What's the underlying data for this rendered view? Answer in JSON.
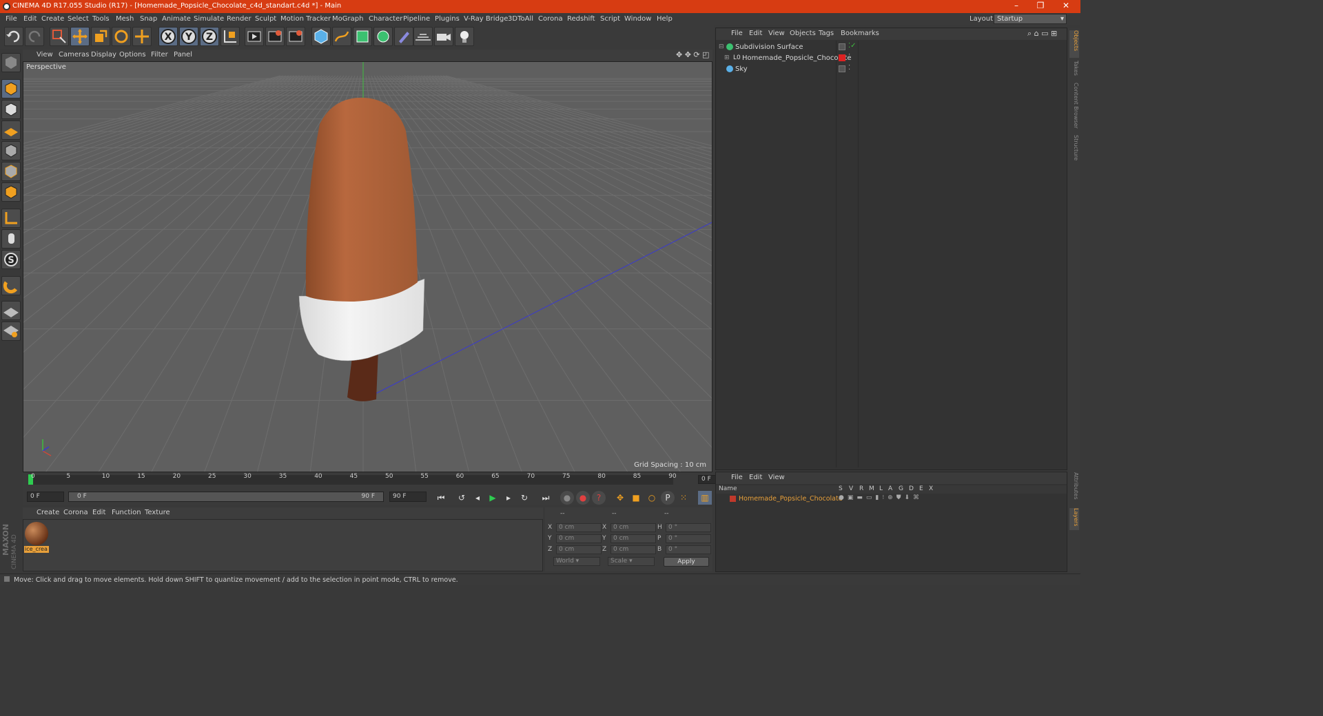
{
  "window": {
    "title": "CINEMA 4D R17.055 Studio (R17) - [Homemade_Popsicle_Chocolate_c4d_standart.c4d *] - Main"
  },
  "menu": [
    "File",
    "Edit",
    "Create",
    "Select",
    "Tools",
    "Mesh",
    "Snap",
    "Animate",
    "Simulate",
    "Render",
    "Sculpt",
    "Motion Tracker",
    "MoGraph",
    "Character",
    "Pipeline",
    "Plugins",
    "V-Ray Bridge",
    "3DToAll",
    "Corona",
    "Redshift",
    "Script",
    "Window",
    "Help"
  ],
  "layout": {
    "label": "Layout:",
    "value": "Startup"
  },
  "viewport": {
    "menu": [
      "View",
      "Cameras",
      "Display",
      "Options",
      "Filter",
      "Panel"
    ],
    "label": "Perspective",
    "grid_spacing": "Grid Spacing : 10 cm"
  },
  "timeline": {
    "ticks": [
      "0",
      "5",
      "10",
      "15",
      "20",
      "25",
      "30",
      "35",
      "40",
      "45",
      "50",
      "55",
      "60",
      "65",
      "70",
      "75",
      "80",
      "85",
      "90"
    ],
    "current_frame": "0 F",
    "start": "0 F",
    "range_start": "0 F",
    "range_end": "90 F",
    "end": "90 F"
  },
  "material_menu": [
    "Create",
    "Corona",
    "Edit",
    "Function",
    "Texture"
  ],
  "materials": [
    {
      "name": "ice_crea"
    }
  ],
  "coords": {
    "headers": [
      "--",
      "--",
      "--"
    ],
    "rows": [
      {
        "a": "X",
        "av": "0 cm",
        "b": "X",
        "bv": "0 cm",
        "c": "H",
        "cv": "0 °"
      },
      {
        "a": "Y",
        "av": "0 cm",
        "b": "Y",
        "bv": "0 cm",
        "c": "P",
        "cv": "0 °"
      },
      {
        "a": "Z",
        "av": "0 cm",
        "b": "Z",
        "bv": "0 cm",
        "c": "B",
        "cv": "0 °"
      }
    ],
    "world": "World",
    "scale": "Scale",
    "apply": "Apply"
  },
  "object_manager": {
    "menu": [
      "File",
      "Edit",
      "View",
      "Objects",
      "Tags",
      "Bookmarks"
    ],
    "objects": [
      {
        "name": "Subdivision Surface",
        "level": 0
      },
      {
        "name": "Homemade_Popsicle_Chocolate",
        "level": 1
      },
      {
        "name": "Sky",
        "level": 0
      }
    ]
  },
  "layer_manager": {
    "menu": [
      "File",
      "Edit",
      "View"
    ],
    "columns": [
      "Name",
      "S",
      "V",
      "R",
      "M",
      "L",
      "A",
      "G",
      "D",
      "E",
      "X"
    ],
    "layers": [
      {
        "name": "Homemade_Popsicle_Chocolate",
        "color": "#c0392b"
      }
    ]
  },
  "right_tabs": [
    "Objects",
    "Takes",
    "Content Browser",
    "Structure",
    "Attributes",
    "Layers"
  ],
  "branding": {
    "maxon": "MAXON",
    "product": "CINEMA 4D"
  },
  "status": "Move: Click and drag to move elements. Hold down SHIFT to quantize movement / add to the selection in point mode, CTRL to remove.",
  "colors": {
    "title_bar": "#d73c12",
    "accent": "#e8a03a",
    "x_axis": "#c94a3a",
    "y_axis": "#3fbf3f",
    "z_axis": "#3a3acf"
  }
}
